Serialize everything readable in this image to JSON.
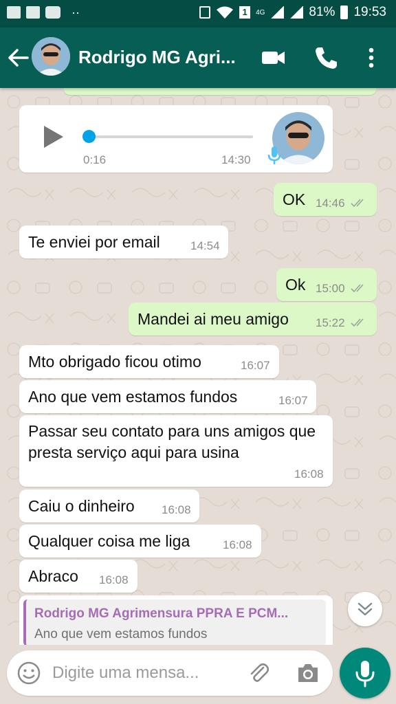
{
  "status_bar": {
    "battery": "81%",
    "time": "19:53",
    "network": "4G",
    "sim": "1",
    "dots": "··"
  },
  "header": {
    "contact_name": "Rodrigo MG Agri...",
    "icons": [
      "back-arrow-icon",
      "avatar",
      "video-call-icon",
      "phone-icon",
      "more-vert-icon"
    ]
  },
  "voice_message": {
    "elapsed": "0:16",
    "time": "14:30",
    "progress": 0.0
  },
  "messages": [
    {
      "dir": "out",
      "text": "OK",
      "time": "14:46",
      "ticks": "double-check"
    },
    {
      "dir": "in",
      "text": "Te enviei por email",
      "time": "14:54"
    },
    {
      "dir": "out",
      "text": "Ok",
      "time": "15:00",
      "ticks": "double-check"
    },
    {
      "dir": "out",
      "text": "Mandei ai meu amigo",
      "time": "15:22",
      "ticks": "double-check"
    },
    {
      "dir": "in",
      "text": "Mto obrigado ficou otimo",
      "time": "16:07"
    },
    {
      "dir": "in",
      "text": "Ano que vem estamos fundos",
      "time": "16:07"
    },
    {
      "dir": "in",
      "text": "Passar seu contato para uns amigos que presta serviço aqui para usina",
      "time": "16:08"
    },
    {
      "dir": "in",
      "text": "Caiu o dinheiro",
      "time": "16:08"
    },
    {
      "dir": "in",
      "text": "Qualquer coisa me liga",
      "time": "16:08"
    },
    {
      "dir": "in",
      "text": "Abraco",
      "time": "16:08"
    }
  ],
  "quoted": {
    "author": "Rodrigo MG Agrimensura PPRA E PCM...",
    "text": "Ano que vem estamos fundos"
  },
  "input": {
    "placeholder": "Digite uma mensa..."
  },
  "colors": {
    "header": "#075e54",
    "status_bar": "#054d44",
    "outgoing_bubble": "#dcf8c6",
    "incoming_bubble": "#ffffff",
    "accent": "#00897b",
    "chat_background": "#e5ddd5"
  }
}
